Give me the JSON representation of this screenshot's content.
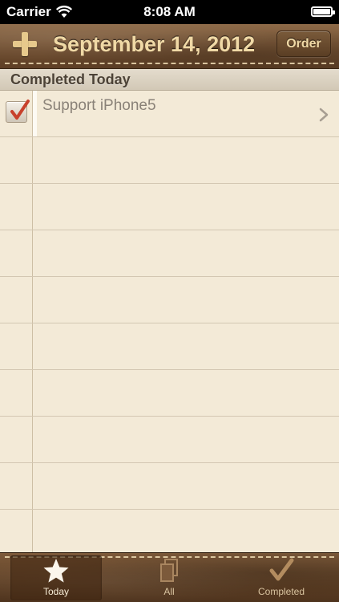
{
  "status_bar": {
    "carrier": "Carrier",
    "time": "8:08 AM",
    "battery_level": 0.9
  },
  "header": {
    "title": "September 14, 2012",
    "order_label": "Order",
    "add_icon": "plus-icon"
  },
  "section": {
    "title": "Completed Today"
  },
  "tasks": [
    {
      "title": "Support iPhone5",
      "completed": true
    }
  ],
  "tab_bar": {
    "tabs": [
      {
        "label": "Today",
        "icon": "star-icon",
        "selected": true
      },
      {
        "label": "All",
        "icon": "documents-icon",
        "selected": false
      },
      {
        "label": "Completed",
        "icon": "checkmark-icon",
        "selected": false
      }
    ]
  },
  "colors": {
    "leather": "#6e4d30",
    "gold_text": "#f0d9a6",
    "paper": "#f3ead7",
    "check_red": "#c8412c"
  }
}
